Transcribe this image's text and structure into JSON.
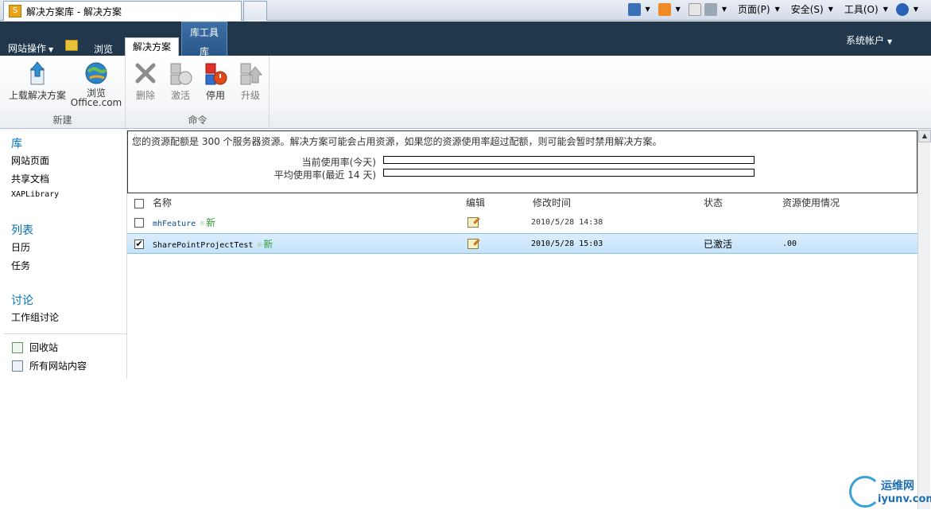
{
  "browser": {
    "tab_title": "解决方案库 - 解决方案",
    "commands": [
      "页面(P)",
      "安全(S)",
      "工具(O)"
    ]
  },
  "topbar": {
    "site_actions": "网站操作",
    "tab_browse": "浏览",
    "tab_solutions": "解决方案",
    "context_group": "库工具",
    "context_tab": "库",
    "user": "系统帐户"
  },
  "ribbon": {
    "group_new": {
      "name": "新建",
      "upload": "上载解决方案",
      "browse_line1": "浏览",
      "browse_line2": "Office.com"
    },
    "group_commands": {
      "name": "命令",
      "delete": "删除",
      "activate": "激活",
      "deactivate": "停用",
      "upgrade": "升级"
    }
  },
  "leftnav": {
    "libraries_head": "库",
    "libraries": [
      "网站页面",
      "共享文档",
      "XAPLibrary"
    ],
    "lists_head": "列表",
    "lists": [
      "日历",
      "任务"
    ],
    "discussions_head": "讨论",
    "discussions": [
      "工作组讨论"
    ],
    "recycle": "回收站",
    "all_content": "所有网站内容"
  },
  "quota": {
    "message": "您的资源配额是 300 个服务器资源。解决方案可能会占用资源，如果您的资源使用率超过配额，则可能会暂时禁用解决方案。",
    "current_label": "当前使用率(今天)",
    "current_fraction": 0,
    "average_label": "平均使用率(最近 14 天)",
    "average_fraction": 0
  },
  "table": {
    "columns": {
      "name": "名称",
      "edit": "编辑",
      "modified": "修改时间",
      "status": "状态",
      "usage": "资源使用情况"
    },
    "rows": [
      {
        "name": "mhFeature",
        "new": "新",
        "modified": "2010/5/28 14:38",
        "status": "",
        "usage": "",
        "checked": false
      },
      {
        "name": "SharePointProjectTest",
        "new": "新",
        "modified": "2010/5/28 15:03",
        "status": "已激活",
        "usage": ".00",
        "checked": true
      }
    ]
  },
  "watermark": {
    "line1": "运维网",
    "line2": "iyunv.com"
  }
}
